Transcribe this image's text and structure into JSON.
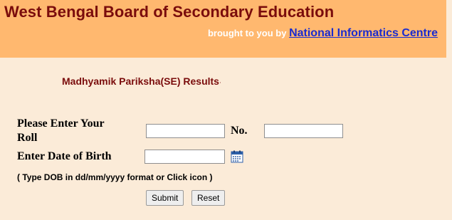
{
  "header": {
    "title": "West Bengal Board of Secondary Education",
    "byline_prefix": "brought to you by ",
    "byline_link": "National Informatics Centre"
  },
  "page": {
    "subtitle": "Madhyamik Pariksha(SE) Results",
    "subtitle_marker": "·"
  },
  "form": {
    "roll_label_line1": "Please Enter Your",
    "roll_label_line2": "Roll",
    "roll_value": "",
    "no_label": "No.",
    "no_value": "",
    "dob_label": "Enter Date of Birth",
    "dob_value": "",
    "dob_note": "( Type DOB in dd/mm/yyyy format or Click icon   )",
    "calendar_icon": "calendar-icon",
    "submit_label": "Submit",
    "reset_label": "Reset"
  },
  "colors": {
    "header_bg": "#ffb86f",
    "body_bg": "#fbebd8",
    "title_color": "#7a0c0c",
    "link_color": "#1a2bd0"
  }
}
